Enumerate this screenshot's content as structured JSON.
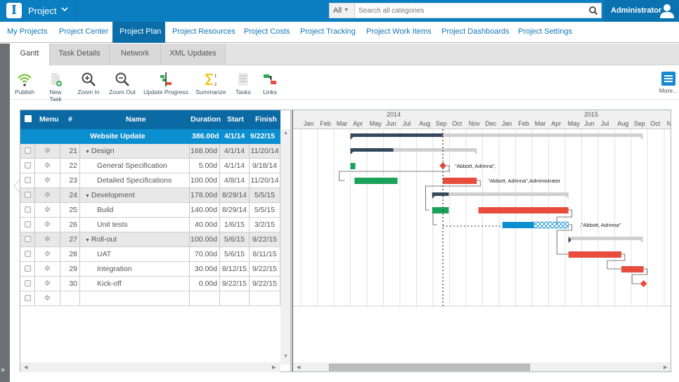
{
  "app": {
    "logo_letter": "I",
    "title": "Project",
    "chevron": "⌵",
    "search_scope": "All",
    "search_placeholder": "Search all categories",
    "user_name": "Administrator"
  },
  "nav": {
    "items": [
      {
        "label": "My Projects",
        "active": false
      },
      {
        "label": "Project Center",
        "active": false
      },
      {
        "label": "Project Plan",
        "active": true
      },
      {
        "label": "Project Resources",
        "active": false
      },
      {
        "label": "Project Costs",
        "active": false
      },
      {
        "label": "Project Tracking",
        "active": false
      },
      {
        "label": "Project Work Items",
        "active": false
      },
      {
        "label": "Project Dashboards",
        "active": false
      },
      {
        "label": "Project Settings",
        "active": false
      }
    ]
  },
  "subtabs": [
    {
      "label": "Gantt",
      "active": true
    },
    {
      "label": "Task Details",
      "active": false
    },
    {
      "label": "Network",
      "active": false
    },
    {
      "label": "XML Updates",
      "active": false
    }
  ],
  "toolbar": {
    "items": [
      {
        "label": "Publish",
        "icon": "wifi-icon"
      },
      {
        "label": "New Task",
        "icon": "new-task-icon"
      },
      {
        "label": "Zoom In",
        "icon": "zoom-in-icon"
      },
      {
        "label": "Zoom Out",
        "icon": "zoom-out-icon"
      },
      {
        "label": "Update Progress",
        "icon": "update-progress-icon"
      },
      {
        "label": "Summarize",
        "icon": "sigma-icon"
      },
      {
        "label": "Tasks",
        "icon": "tasks-list-icon"
      },
      {
        "label": "Links",
        "icon": "links-icon"
      }
    ],
    "more_label": "More..."
  },
  "grid": {
    "columns": {
      "menu": "Menu",
      "num": "#",
      "name": "Name",
      "duration": "Duration",
      "start": "Start",
      "finish": "Finish"
    },
    "summary": {
      "name": "Website Update",
      "duration": "386.00d",
      "start": "4/1/14",
      "finish": "9/22/15"
    },
    "rows": [
      {
        "num": "21",
        "name": "Design",
        "duration": "168.00d",
        "start": "4/1/14",
        "finish": "11/20/14",
        "group": true
      },
      {
        "num": "22",
        "name": "General Specification",
        "duration": "5.00d",
        "start": "4/1/14",
        "finish": "9/18/14",
        "group": false
      },
      {
        "num": "23",
        "name": "Detailed Specifications",
        "duration": "100.00d",
        "start": "4/8/14",
        "finish": "11/20/14",
        "group": false
      },
      {
        "num": "24",
        "name": "Development",
        "duration": "178.00d",
        "start": "8/29/14",
        "finish": "5/5/15",
        "group": true
      },
      {
        "num": "25",
        "name": "Build",
        "duration": "140.00d",
        "start": "8/29/14",
        "finish": "5/5/15",
        "group": false
      },
      {
        "num": "26",
        "name": "Unit tests",
        "duration": "40.00d",
        "start": "1/6/15",
        "finish": "3/2/15",
        "group": false
      },
      {
        "num": "27",
        "name": "Roll-out",
        "duration": "100.00d",
        "start": "5/6/15",
        "finish": "9/22/15",
        "group": true
      },
      {
        "num": "28",
        "name": "UAT",
        "duration": "70.00d",
        "start": "5/6/15",
        "finish": "8/11/15",
        "group": false
      },
      {
        "num": "29",
        "name": "Integration",
        "duration": "30.00d",
        "start": "8/12/15",
        "finish": "9/22/15",
        "group": false
      },
      {
        "num": "30",
        "name": "Kick-off",
        "duration": "0.00d",
        "start": "9/22/15",
        "finish": "9/22/15",
        "group": false
      },
      {
        "num": "",
        "name": "",
        "duration": "",
        "start": "",
        "finish": "",
        "group": false
      }
    ]
  },
  "gantt": {
    "years": [
      "2014",
      "2015"
    ],
    "months": [
      "Jan",
      "Feb",
      "Mar",
      "Apr",
      "May",
      "Jun",
      "Jul",
      "Aug",
      "Sep",
      "Oct",
      "Nov",
      "Dec",
      "Jan",
      "Feb",
      "Mar",
      "Apr",
      "May",
      "Jun",
      "Jul",
      "Aug",
      "Sep",
      "Oct",
      "Nov"
    ],
    "resource_labels": {
      "row22": "\"Abbott, Adrinna\",",
      "row23": "\"Abbott, Adrinna\",Administrator",
      "row26": ",\"Abbott, Adrinna\""
    },
    "colors": {
      "summary_done": "#34495e",
      "summary_remaining": "#cfcfcf",
      "complete": "#1aa15a",
      "critical": "#e84c3d",
      "normal": "#0b8fd0"
    }
  }
}
